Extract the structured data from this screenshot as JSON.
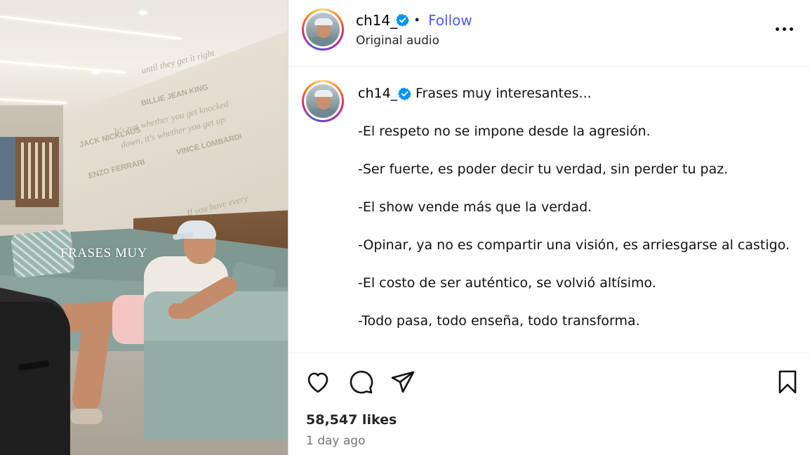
{
  "media": {
    "overlay_caption": "FRASES MUY",
    "wall_quotes": [
      "until they get it right",
      "BILLIE JEAN KING",
      "It's not whether you get knocked",
      "down, it's whether you get up.",
      "VINCE LOMBARDI",
      "JACK NICKLAUS",
      "ENZO FERRARI",
      "If you have every"
    ]
  },
  "header": {
    "username": "ch14_",
    "separator": "•",
    "follow_label": "Follow",
    "audio_label": "Original audio",
    "more_icon": "more-horizontal-icon"
  },
  "caption": {
    "username": "ch14_",
    "title": "Frases muy interesantes...",
    "lines": [
      "-El respeto no se impone desde la agresión.",
      "-Ser fuerte, es poder decir tu verdad, sin perder tu paz.",
      "-El show vende más que la verdad.",
      "-Opinar, ya no es compartir una visión, es arriesgarse al castigo.",
      "-El costo de ser auténtico, se volvió altísimo.",
      "-Todo pasa, todo enseña, todo transforma."
    ]
  },
  "actions": {
    "icons": [
      "heart-icon",
      "comment-icon",
      "share-icon",
      "bookmark-icon"
    ]
  },
  "stats": {
    "likes": "58,547 likes",
    "time_ago": "1 day ago"
  },
  "colors": {
    "follow_blue": "#4a5ee8",
    "verified_blue": "#0095f6",
    "divider": "#efefef"
  }
}
